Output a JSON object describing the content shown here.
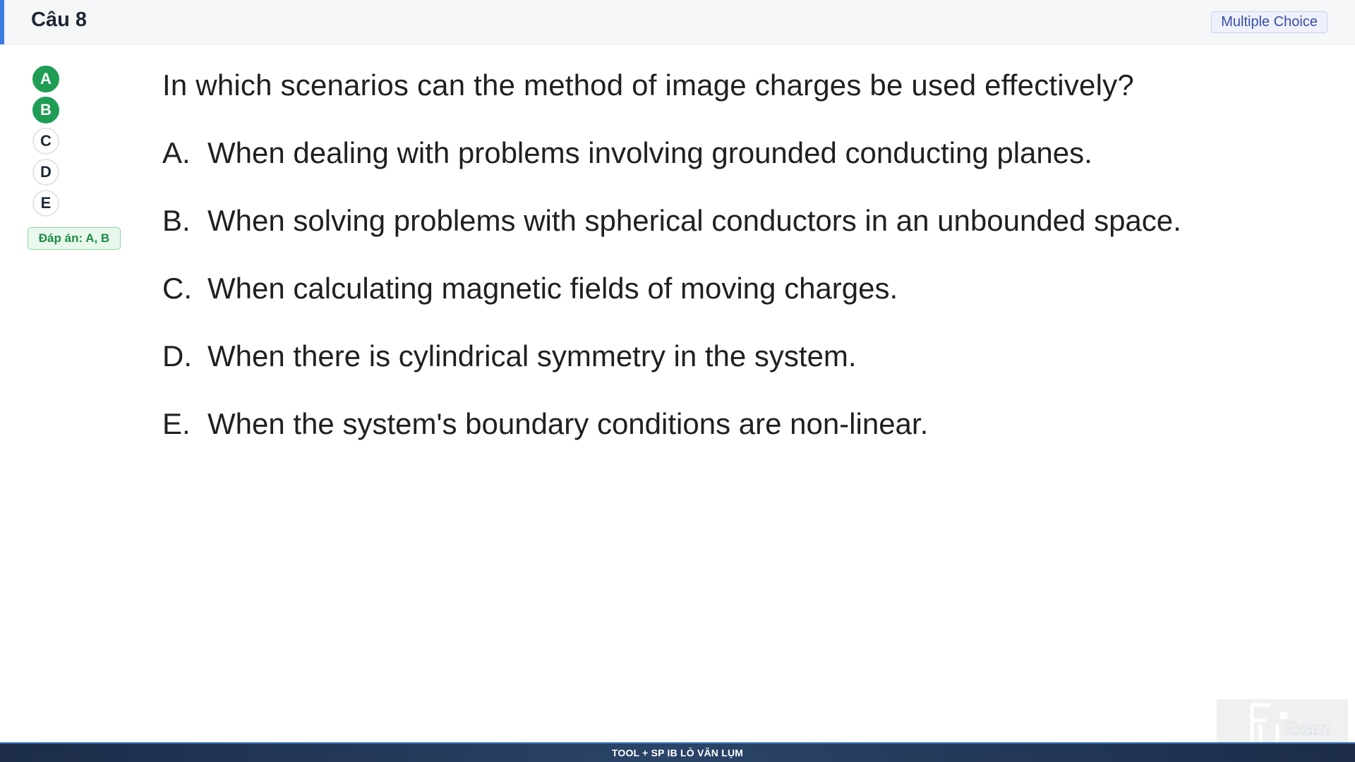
{
  "header": {
    "title": "Câu 8",
    "question_type": "Multiple Choice"
  },
  "sidebar": {
    "choices": [
      {
        "label": "A",
        "selected": true
      },
      {
        "label": "B",
        "selected": true
      },
      {
        "label": "C",
        "selected": false
      },
      {
        "label": "D",
        "selected": false
      },
      {
        "label": "E",
        "selected": false
      }
    ],
    "answer_label": "Đáp án: A, B"
  },
  "question": {
    "text": "In which scenarios can the method of image charges be used effectively?",
    "options": [
      {
        "letter": "A.",
        "text": "When dealing with problems involving grounded conducting planes."
      },
      {
        "letter": "B.",
        "text": "When solving problems with spherical conductors in an unbounded space."
      },
      {
        "letter": "C.",
        "text": "When calculating magnetic fields of moving charges."
      },
      {
        "letter": "D.",
        "text": "When there is cylindrical symmetry in the system."
      },
      {
        "letter": "E.",
        "text": "When the system's boundary conditions are non-linear."
      }
    ]
  },
  "logo": {
    "brand_text": "Exam"
  },
  "footer": {
    "text": "TOOL + SP IB LÒ VĂN LỤM"
  },
  "colors": {
    "accent": "#3d7be0",
    "selected": "#1f9d55",
    "badge_bg": "#e8f8ec",
    "footer_bg": "#1c2c48"
  }
}
